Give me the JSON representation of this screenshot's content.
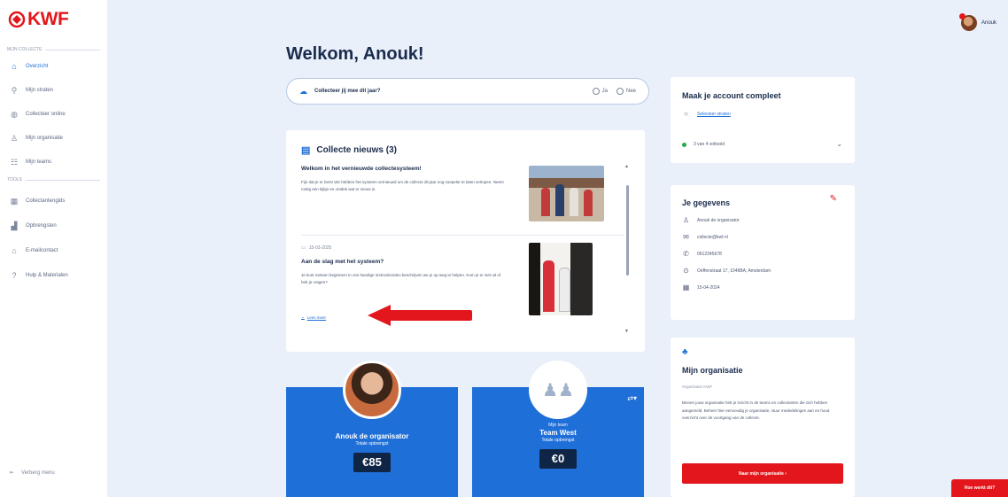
{
  "brand": {
    "name": "KWF",
    "color": "#e3161b",
    "accent": "#1f6fd8"
  },
  "sidebar": {
    "section_main": "Mijn collecte",
    "items": [
      {
        "label": "Overzicht",
        "icon": "home-icon",
        "active": true
      },
      {
        "label": "Mijn straten",
        "icon": "route-icon",
        "active": false
      },
      {
        "label": "Collecteer online",
        "icon": "globe-icon",
        "active": false
      },
      {
        "label": "Mijn organisatie",
        "icon": "org-icon",
        "active": false
      },
      {
        "label": "Mijn teams",
        "icon": "team-icon",
        "active": false
      }
    ],
    "section_tools": "Tools",
    "tools": [
      {
        "label": "Collectantengids",
        "icon": "grid-icon"
      },
      {
        "label": "Opbrengsten",
        "icon": "bar-chart-icon"
      },
      {
        "label": "E-mailcontact",
        "icon": "mail-icon"
      },
      {
        "label": "Hulp & Materialen",
        "icon": "help-icon"
      }
    ],
    "collapse_label": "Verberg menu"
  },
  "user": {
    "name": "Anouk"
  },
  "page": {
    "title": "Welkom, Anouk!"
  },
  "question": {
    "text": "Collecteer jij mee dit jaar?",
    "option_yes": "Ja",
    "option_no": "Nee"
  },
  "news": {
    "title": "Collecte nieuws (3)",
    "items": [
      {
        "title": "Welkom in het vernieuwde collectesysteem!",
        "body": "Fijn dat je er bent! We hebben het systeem vernieuwd om de collecte dit jaar nog soepeler te laten verlopen. Neem rustig een kijkje en ontdek wat er nieuw is."
      },
      {
        "date": "15-03-2025",
        "title": "Aan de slag met het systeem?",
        "body": "Je kunt meteen beginnen! In ons handige instructievideo beschrijven we je op weg te helpen. Kom je er niet uit of heb je vragen?"
      }
    ],
    "read_more": "Lees meer"
  },
  "profile_cards": [
    {
      "name": "Anouk de organisator",
      "label": "Totale opbrengst",
      "amount": "€85"
    },
    {
      "sub": "Mijn team",
      "name": "Team West",
      "label": "Totale opbrengst",
      "amount": "€0"
    }
  ],
  "account": {
    "title": "Maak je account compleet",
    "step_link": "Selecteer straten",
    "progress": "3 van 4 voltooid"
  },
  "details": {
    "title": "Je gegevens",
    "name": "Anouk de organisator",
    "email": "collecte@kwf.nl",
    "phone": "0612345678",
    "address": "Oeffenstraat 17, 1046BA, Amsterdam",
    "date": "15-04-2024"
  },
  "organisation": {
    "title": "Mijn organisatie",
    "subtitle": "Organisatie KWF",
    "body": "Binnen jouw organisatie heb je inzicht in de teams en collectanten die zich hebben aangemeld. Beheer hier eenvoudig je organisatie, stuur mededelingen aan en houd overzicht over de voortgang van de collecte.",
    "button": "Naar mijn organisatie"
  },
  "help_tab": "Hoe werkt dit?"
}
